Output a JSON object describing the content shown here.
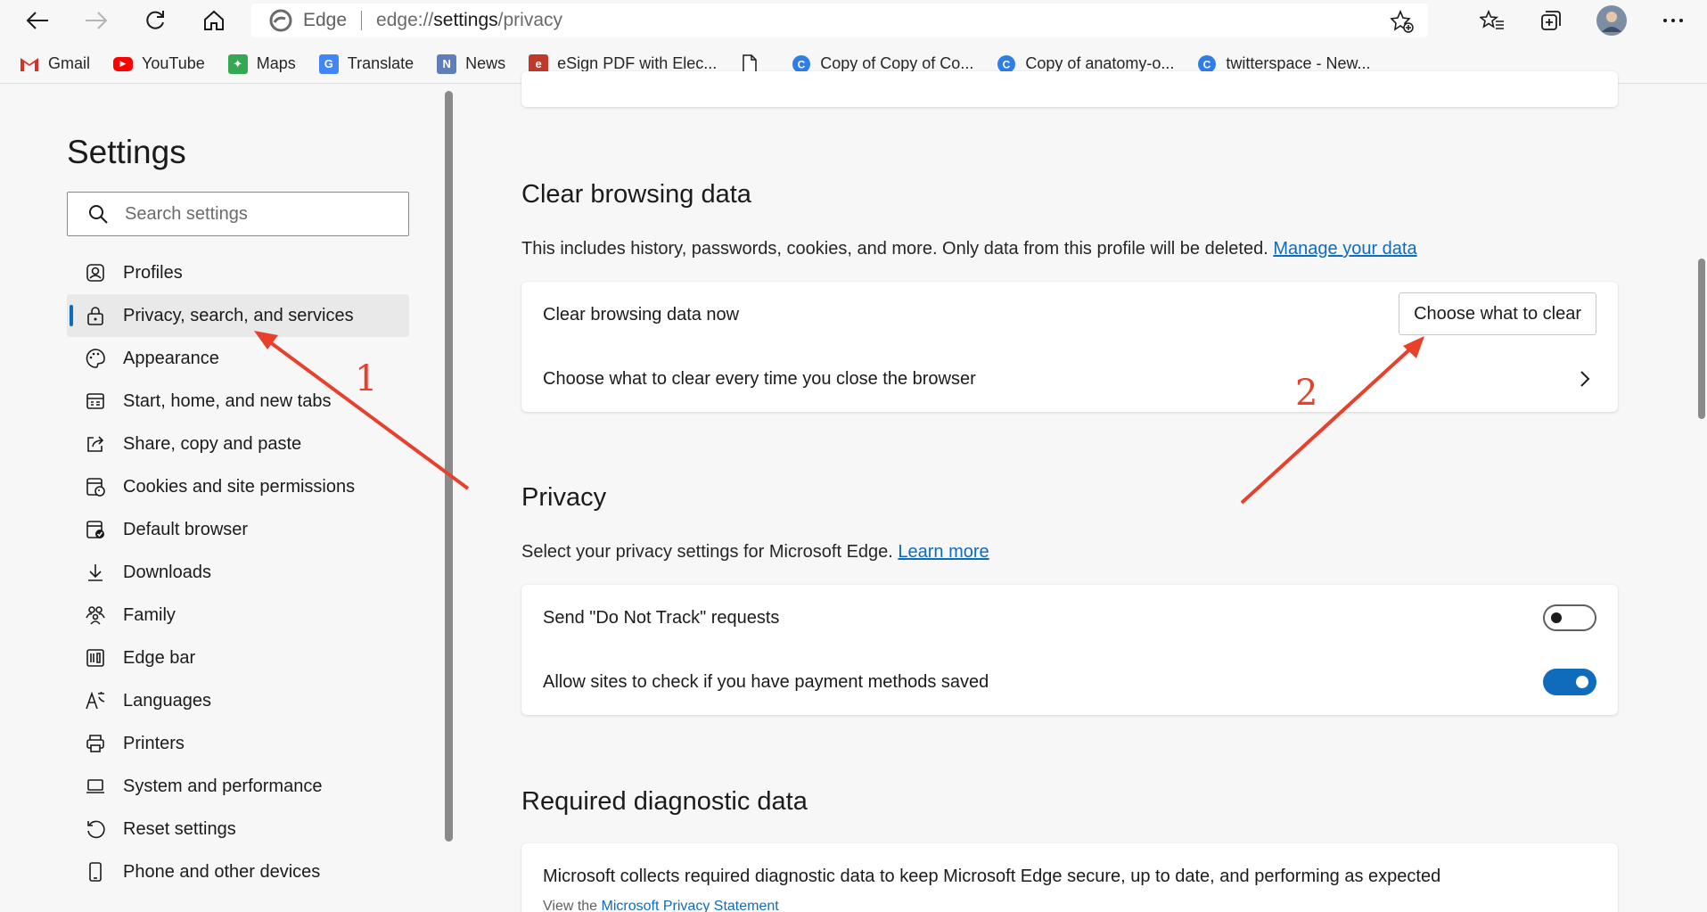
{
  "browser": {
    "brand": "Edge",
    "url_prefix": "edge://",
    "url_path": "settings",
    "url_suffix": "/privacy",
    "icons": [
      "back-icon",
      "forward-icon",
      "refresh-icon",
      "home-icon",
      "favorite-add-icon",
      "favorites-icon",
      "collections-icon",
      "profile-avatar",
      "more-icon"
    ]
  },
  "bookmarks": [
    {
      "label": "Gmail",
      "icon": "gmail-icon",
      "color": "#d93025",
      "glyph": "M"
    },
    {
      "label": "YouTube",
      "icon": "youtube-icon",
      "color": "#ff0000",
      "glyph": "▶"
    },
    {
      "label": "Maps",
      "icon": "maps-icon",
      "color": "#34a853",
      "glyph": "✦"
    },
    {
      "label": "Translate",
      "icon": "translate-icon",
      "color": "#4285f4",
      "glyph": "G"
    },
    {
      "label": "News",
      "icon": "news-icon",
      "color": "#5f7fb8",
      "glyph": "N"
    },
    {
      "label": "eSign PDF with Elec...",
      "icon": "esign-icon",
      "color": "#c0392b",
      "glyph": "e"
    },
    {
      "label": "",
      "icon": "document-icon",
      "color": "#ffffff",
      "glyph": ""
    },
    {
      "label": "Copy of Copy of Co...",
      "icon": "canva-icon",
      "color": "#2f7ee8",
      "glyph": "C"
    },
    {
      "label": "Copy of anatomy-o...",
      "icon": "canva-icon",
      "color": "#2f7ee8",
      "glyph": "C"
    },
    {
      "label": "twitterspace - New...",
      "icon": "canva-icon",
      "color": "#2f7ee8",
      "glyph": "C"
    }
  ],
  "sidebar": {
    "title": "Settings",
    "search_placeholder": "Search settings",
    "items": [
      {
        "label": "Profiles",
        "icon": "profiles-icon"
      },
      {
        "label": "Privacy, search, and services",
        "icon": "lock-icon",
        "active": true
      },
      {
        "label": "Appearance",
        "icon": "palette-icon"
      },
      {
        "label": "Start, home, and new tabs",
        "icon": "start-tabs-icon"
      },
      {
        "label": "Share, copy and paste",
        "icon": "share-icon"
      },
      {
        "label": "Cookies and site permissions",
        "icon": "cookies-icon"
      },
      {
        "label": "Default browser",
        "icon": "default-browser-icon"
      },
      {
        "label": "Downloads",
        "icon": "download-icon"
      },
      {
        "label": "Family",
        "icon": "family-icon"
      },
      {
        "label": "Edge bar",
        "icon": "edge-bar-icon"
      },
      {
        "label": "Languages",
        "icon": "languages-icon"
      },
      {
        "label": "Printers",
        "icon": "printer-icon"
      },
      {
        "label": "System and performance",
        "icon": "laptop-icon"
      },
      {
        "label": "Reset settings",
        "icon": "reset-icon"
      },
      {
        "label": "Phone and other devices",
        "icon": "phone-icon"
      }
    ]
  },
  "clear_browsing": {
    "title": "Clear browsing data",
    "description": "This includes history, passwords, cookies, and more. Only data from this profile will be deleted.",
    "manage_link": "Manage your data",
    "row1_label": "Clear browsing data now",
    "row1_button": "Choose what to clear",
    "row2_label": "Choose what to clear every time you close the browser"
  },
  "privacy": {
    "title": "Privacy",
    "description": "Select your privacy settings for Microsoft Edge.",
    "learn_more": "Learn more",
    "dnt_label": "Send \"Do Not Track\" requests",
    "dnt_on": false,
    "payment_label": "Allow sites to check if you have payment methods saved",
    "payment_on": true
  },
  "diagnostic": {
    "title": "Required diagnostic data",
    "text": "Microsoft collects required diagnostic data to keep Microsoft Edge secure, up to date, and performing as expected",
    "view_prefix": "View the",
    "privacy_link": "Microsoft Privacy Statement"
  },
  "annotations": {
    "label1": "1",
    "label2": "2",
    "color": "#e8402b"
  }
}
